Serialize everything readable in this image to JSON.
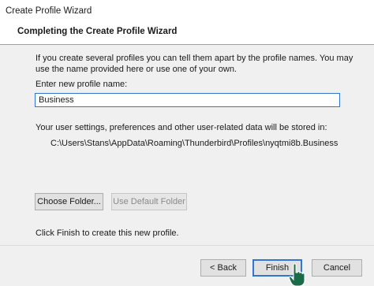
{
  "window": {
    "title": "Create Profile Wizard"
  },
  "header": {
    "heading": "Completing the Create Profile Wizard"
  },
  "main": {
    "intro": "If you create several profiles you can tell them apart by the profile names. You may use the name provided here or use one of your own.",
    "name_label": "Enter new profile name:",
    "name_value": "Business",
    "storage_label": "Your user settings, preferences and other user-related data will be stored in:",
    "storage_path": "C:\\Users\\Stans\\AppData\\Roaming\\Thunderbird\\Profiles\\nyqtmi8b.Business",
    "choose_folder_label": "Choose Folder...",
    "default_folder_label": "Use Default Folder",
    "finish_note": "Click Finish to create this new profile."
  },
  "footer": {
    "back_label": "< Back",
    "finish_label": "Finish",
    "cancel_label": "Cancel"
  },
  "colors": {
    "accent": "#3375d6",
    "cursor": "#1a6b4a"
  },
  "icons": {
    "cursor": "hand-pointer-icon"
  }
}
